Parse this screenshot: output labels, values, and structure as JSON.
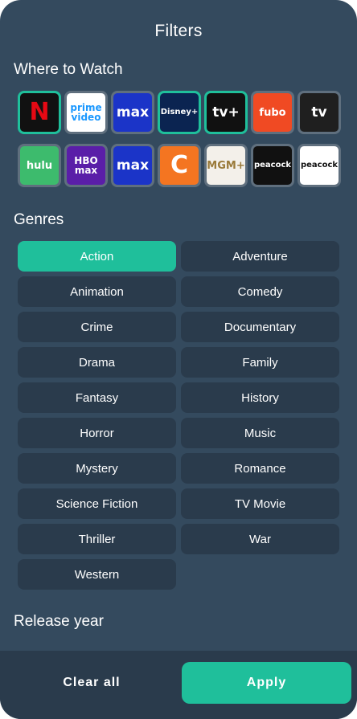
{
  "header": {
    "title": "Filters"
  },
  "sections": {
    "where_to_watch": "Where to Watch",
    "genres": "Genres",
    "release_year": "Release year"
  },
  "providers": [
    {
      "name": "Netflix",
      "logo": "N",
      "bg": "#111111",
      "fg": "#e50914",
      "selected": true
    },
    {
      "name": "Prime Video",
      "logo": "prime video",
      "bg": "#ffffff",
      "fg": "#1a98ff",
      "selected": false
    },
    {
      "name": "Max (Prime Video Channels)",
      "logo": "max",
      "bg": "#1b34c8",
      "fg": "#ffffff",
      "selected": false
    },
    {
      "name": "Disney+",
      "logo": "Disney+",
      "bg": "#0b2451",
      "fg": "#ffffff",
      "selected": true
    },
    {
      "name": "Apple TV+",
      "logo": "tv+",
      "bg": "#111111",
      "fg": "#ffffff",
      "selected": true
    },
    {
      "name": "fuboTV",
      "logo": "fubo",
      "bg": "#f04a23",
      "fg": "#ffffff",
      "selected": false
    },
    {
      "name": "Apple TV",
      "logo": "tv",
      "bg": "#1f1f1f",
      "fg": "#ffffff",
      "selected": false
    },
    {
      "name": "Hulu",
      "logo": "hulu",
      "bg": "#3dbb6d",
      "fg": "#ffffff",
      "selected": false
    },
    {
      "name": "HBO Max",
      "logo": "HBO max",
      "bg": "#5a1ea8",
      "fg": "#ffffff",
      "selected": false
    },
    {
      "name": "Max",
      "logo": "max",
      "bg": "#1b34c8",
      "fg": "#ffffff",
      "selected": false
    },
    {
      "name": "Crunchyroll",
      "logo": "C",
      "bg": "#f47521",
      "fg": "#ffffff",
      "selected": false
    },
    {
      "name": "MGM+",
      "logo": "MGM+",
      "bg": "#f3f0ea",
      "fg": "#9a7a3a",
      "selected": false
    },
    {
      "name": "Peacock",
      "logo": "peacock",
      "bg": "#111111",
      "fg": "#ffffff",
      "selected": false
    },
    {
      "name": "Peacock Premium",
      "logo": "peacock",
      "bg": "#ffffff",
      "fg": "#111111",
      "selected": false
    }
  ],
  "genres": [
    {
      "label": "Action",
      "selected": true
    },
    {
      "label": "Adventure",
      "selected": false
    },
    {
      "label": "Animation",
      "selected": false
    },
    {
      "label": "Comedy",
      "selected": false
    },
    {
      "label": "Crime",
      "selected": false
    },
    {
      "label": "Documentary",
      "selected": false
    },
    {
      "label": "Drama",
      "selected": false
    },
    {
      "label": "Family",
      "selected": false
    },
    {
      "label": "Fantasy",
      "selected": false
    },
    {
      "label": "History",
      "selected": false
    },
    {
      "label": "Horror",
      "selected": false
    },
    {
      "label": "Music",
      "selected": false
    },
    {
      "label": "Mystery",
      "selected": false
    },
    {
      "label": "Romance",
      "selected": false
    },
    {
      "label": "Science Fiction",
      "selected": false
    },
    {
      "label": "TV Movie",
      "selected": false
    },
    {
      "label": "Thriller",
      "selected": false
    },
    {
      "label": "War",
      "selected": false
    },
    {
      "label": "Western",
      "selected": false
    }
  ],
  "footer": {
    "clear_label": "Clear all",
    "apply_label": "Apply"
  },
  "colors": {
    "accent": "#1fbf9b",
    "background": "#344a5e",
    "chip": "#2a3b4c"
  }
}
